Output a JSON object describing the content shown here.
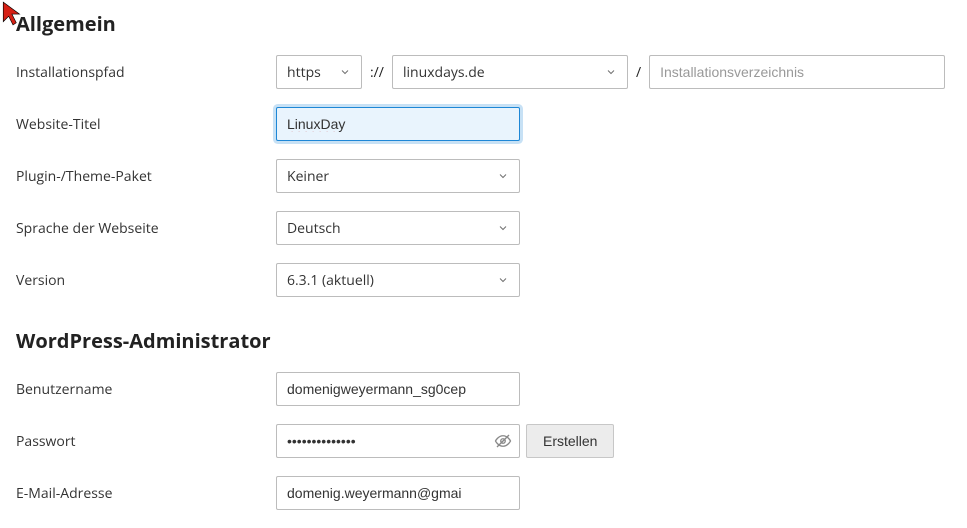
{
  "sections": {
    "general_title": "Allgemein",
    "admin_title": "WordPress-Administrator"
  },
  "labels": {
    "install_path": "Installationspfad",
    "website_title": "Website-Titel",
    "plugin_theme": "Plugin-/Theme-Paket",
    "language": "Sprache der Webseite",
    "version": "Version",
    "username": "Benutzername",
    "password": "Passwort",
    "email": "E-Mail-Adresse"
  },
  "install_path": {
    "protocol": "https",
    "separator_scheme": "://",
    "domain": "linuxdays.de",
    "separator_path": "/",
    "dir_placeholder": "Installationsverzeichnis"
  },
  "website_title": "LinuxDay",
  "plugin_theme_value": "Keiner",
  "language_value": "Deutsch",
  "version_value": "6.3.1 (aktuell)",
  "admin": {
    "username": "domenigweyermann_sg0cep",
    "password_masked": "••••••••••••••",
    "generate_btn": "Erstellen",
    "email": "domenig.weyermann@gmai"
  }
}
